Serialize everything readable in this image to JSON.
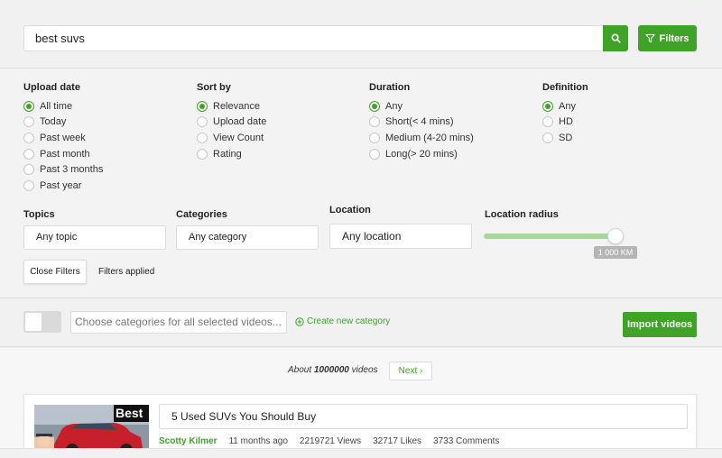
{
  "search": {
    "query": "best suvs",
    "filters_label": "Filters"
  },
  "upload_date": {
    "title": "Upload date",
    "options": [
      "All time",
      "Today",
      "Past week",
      "Past month",
      "Past 3 months",
      "Past year"
    ],
    "selected": 0
  },
  "sort_by": {
    "title": "Sort by",
    "options": [
      "Relevance",
      "Upload date",
      "View Count",
      "Rating"
    ],
    "selected": 0
  },
  "duration": {
    "title": "Duration",
    "options": [
      "Any",
      "Short(< 4 mins)",
      "Medium (4-20 mins)",
      "Long(> 20 mins)"
    ],
    "selected": 0
  },
  "definition": {
    "title": "Definition",
    "options": [
      "Any",
      "HD",
      "SD"
    ],
    "selected": 0
  },
  "topics": {
    "label": "Topics",
    "value": "Any topic"
  },
  "categories": {
    "label": "Categories",
    "value": "Any category"
  },
  "location": {
    "label": "Location",
    "placeholder": "Any location"
  },
  "location_radius": {
    "label": "Location radius",
    "value_text": "1 000 KM",
    "level": 1.0
  },
  "close_filters_label": "Close Filters",
  "filters_applied_label": "Filters applied",
  "import": {
    "category_placeholder": "Choose categories for all selected videos...",
    "create_category_label": "Create new category",
    "import_button_label": "Import videos"
  },
  "results": {
    "about_prefix": "About",
    "count": "1000000",
    "about_suffix": "videos",
    "next_label": "Next",
    "videos": [
      {
        "thumb_text": "Best",
        "title": "5 Used SUVs You Should Buy",
        "author": "Scotty Kilmer",
        "age": "11 months ago",
        "views": "2219721 Views",
        "likes": "32717 Likes",
        "comments": "3733 Comments"
      }
    ]
  },
  "colors": {
    "accent": "#3ea326",
    "slider_fill": "#a7d79b"
  }
}
